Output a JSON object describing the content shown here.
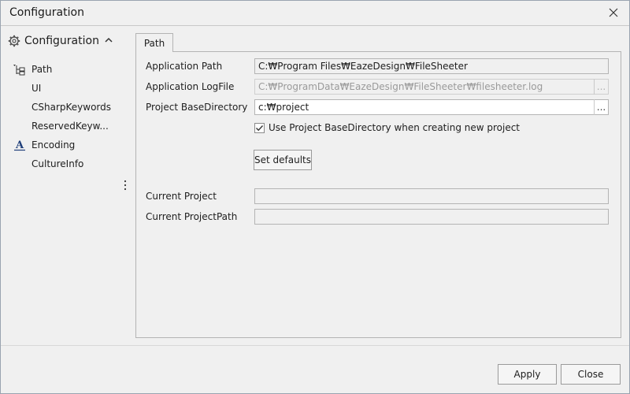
{
  "window": {
    "title": "Configuration"
  },
  "sidebar": {
    "header": "Configuration",
    "items": [
      {
        "label": "Path",
        "icon": "path-tree-icon"
      },
      {
        "label": "UI",
        "icon": ""
      },
      {
        "label": "CSharpKeywords",
        "icon": ""
      },
      {
        "label": "ReservedKeyw...",
        "icon": ""
      },
      {
        "label": "Encoding",
        "icon": "font-a-icon"
      },
      {
        "label": "CultureInfo",
        "icon": ""
      }
    ]
  },
  "tabs": [
    {
      "label": "Path"
    }
  ],
  "form": {
    "application_path_label": "Application Path",
    "application_path_value": "C:₩Program Files₩EazeDesign₩FileSheeter",
    "application_logfile_label": "Application LogFile",
    "application_logfile_value": "C:₩ProgramData₩EazeDesign₩FileSheeter₩filesheeter.log",
    "project_basedir_label": "Project BaseDirectory",
    "project_basedir_value": "c:₩project",
    "ellipsis": "...",
    "use_basedir_checkbox_label": "Use Project BaseDirectory when creating new project",
    "use_basedir_checked": true,
    "set_defaults_label": "Set defaults",
    "current_project_label": "Current Project",
    "current_project_value": "",
    "current_projectpath_label": "Current ProjectPath",
    "current_projectpath_value": ""
  },
  "footer": {
    "apply_label": "Apply",
    "close_label": "Close"
  },
  "colors": {
    "window_bg": "#f0f0f0",
    "border": "#b4b4b4",
    "encoding_icon": "#1f3f7a"
  }
}
